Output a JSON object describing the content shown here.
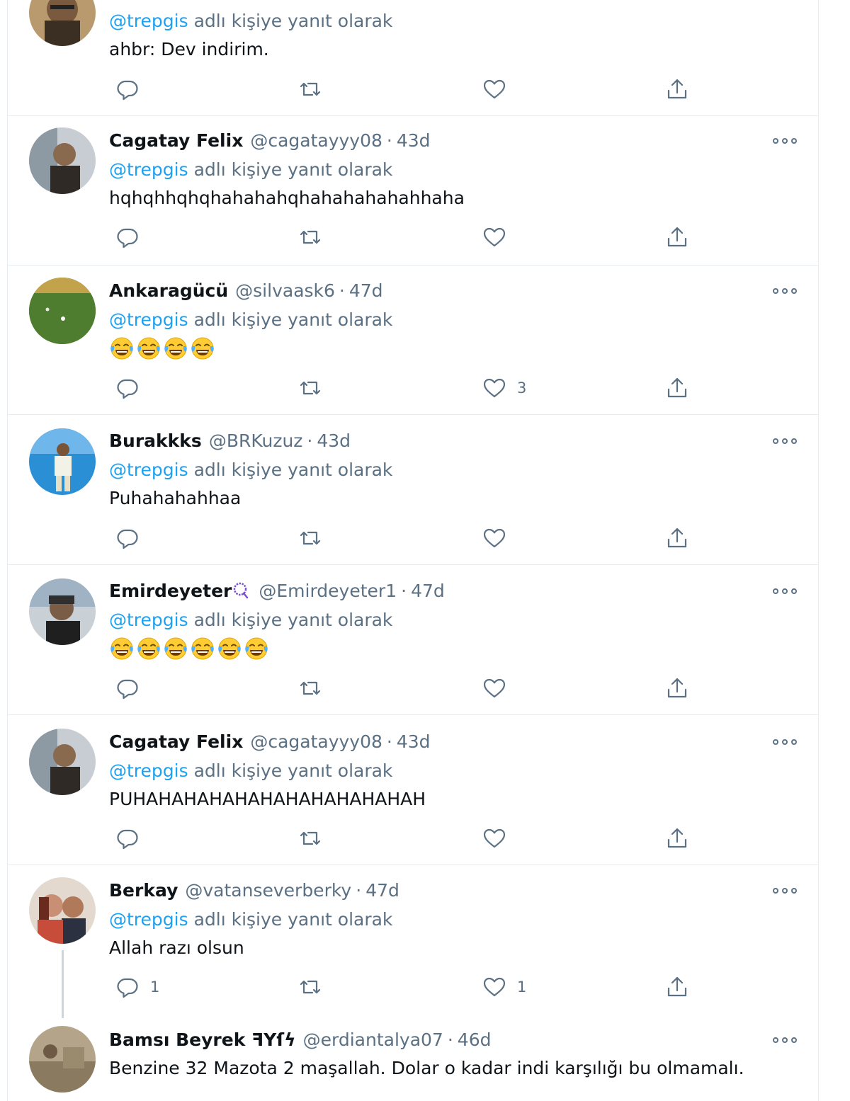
{
  "reply_prefix": "adlı kişiye yanıt olarak",
  "colors": {
    "link": "#1da1f2",
    "secondary": "#5b7083",
    "border": "#e6ecf0"
  },
  "icons": {
    "reply": "reply-icon",
    "retweet": "retweet-icon",
    "like": "heart-icon",
    "share": "share-icon",
    "more": "more-icon"
  },
  "tweets": [
    {
      "reply_to": "@trepgis",
      "text": "ahbr: Dev indirim.",
      "reply_count": "",
      "like_count": ""
    },
    {
      "name": "Cagatay Felix",
      "handle": "@cagatayyy08",
      "time": "43d",
      "reply_to": "@trepgis",
      "text": "hqhqhhqhqhahahahqhahahahahahhaha",
      "reply_count": "",
      "like_count": ""
    },
    {
      "name": "Ankaragücü",
      "handle": "@silvaask6",
      "time": "47d",
      "reply_to": "@trepgis",
      "emoji_count": 4,
      "emoji_name": "face-with-tears-of-joy",
      "reply_count": "",
      "like_count": "3"
    },
    {
      "name": "Burakkks",
      "handle": "@BRKuzuz",
      "time": "43d",
      "reply_to": "@trepgis",
      "text": "Puhahahahhaa",
      "reply_count": "",
      "like_count": ""
    },
    {
      "name": "Emirdeyeter",
      "name_badge": "prayer-beads-icon",
      "handle": "@Emirdeyeter1",
      "time": "47d",
      "reply_to": "@trepgis",
      "emoji_count": 6,
      "emoji_name": "face-with-tears-of-joy",
      "reply_count": "",
      "like_count": ""
    },
    {
      "name": "Cagatay Felix",
      "handle": "@cagatayyy08",
      "time": "43d",
      "reply_to": "@trepgis",
      "text": "PUHAHAHAHAHAHAHAHAHAHAHAH",
      "reply_count": "",
      "like_count": ""
    },
    {
      "name": "Berkay",
      "handle": "@vatanseverberky",
      "time": "47d",
      "reply_to": "@trepgis",
      "text": "Allah razı olsun",
      "reply_count": "1",
      "like_count": "1"
    },
    {
      "name": "Bamsı Beyrek",
      "name_suffix": "ꟻYſϟ",
      "handle": "@erdiantalya07",
      "time": "46d",
      "text": "Benzine 32 Mazota 2 maşallah. Dolar o kadar indi karşılığı bu olmamalı."
    }
  ]
}
